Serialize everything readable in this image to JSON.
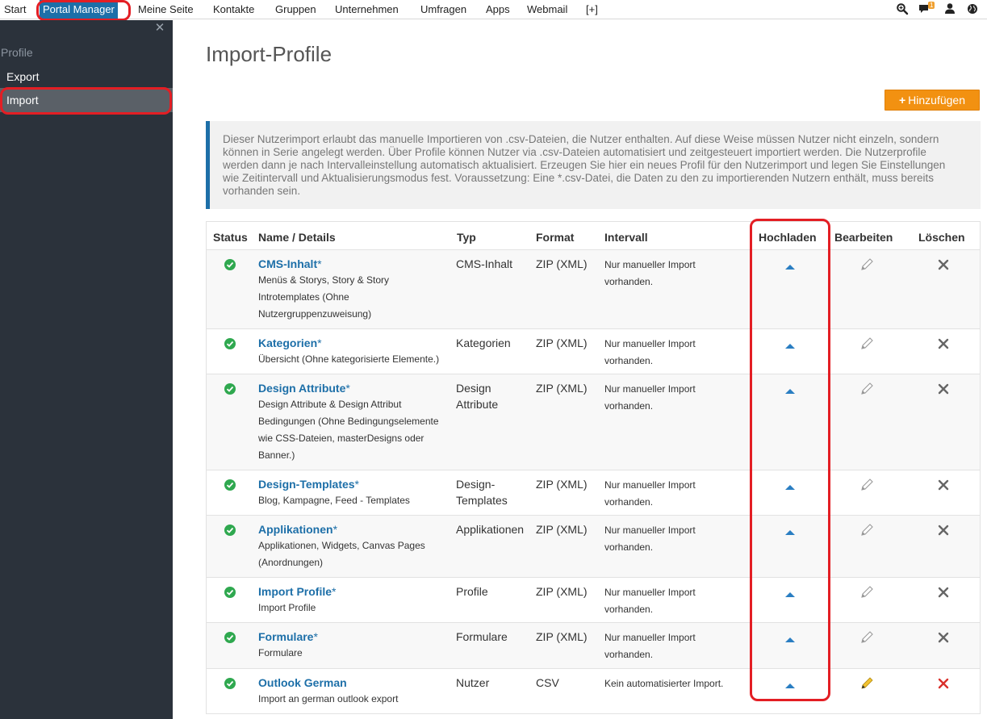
{
  "topnav": {
    "items": [
      "Start",
      "Portal Manager",
      "Meine Seite",
      "Kontakte",
      "Gruppen",
      "Unternehmen",
      "Umfragen",
      "Apps",
      "Webmail",
      "[+]"
    ],
    "active_index": 1,
    "notification_count": "1",
    "icons": [
      "search-icon",
      "chat-icon",
      "user-icon",
      "globe-icon"
    ]
  },
  "sidebar": {
    "section": "Profile",
    "items": [
      "Export",
      "Import"
    ],
    "active_index": 1
  },
  "main": {
    "title": "Import-Profile",
    "add_label": "Hinzufügen",
    "info": "Dieser Nutzerimport erlaubt das manuelle Importieren von .csv-Dateien, die Nutzer enthalten. Auf diese Weise müssen Nutzer nicht einzeln, sondern können in Serie angelegt werden. Über Profile können Nutzer via .csv-Dateien automatisiert und zeitgesteuert importiert werden. Die Nutzerprofile werden dann je nach Intervalleinstellung automatisch aktualisiert. Erzeugen Sie hier ein neues Profil für den Nutzerimport und legen Sie Einstellungen wie Zeitintervall und Aktualisierungsmodus fest. Voraussetzung: Eine *.csv-Datei, die Daten zu den zu importierenden Nutzern enthält, muss bereits vorhanden sein."
  },
  "table": {
    "headers": {
      "status": "Status",
      "name": "Name / Details",
      "type": "Typ",
      "format": "Format",
      "interval": "Intervall",
      "upload": "Hochladen",
      "edit": "Bearbeiten",
      "delete": "Löschen"
    },
    "rows": [
      {
        "name": "CMS-Inhalt",
        "star": "*",
        "detail": "Menüs & Storys, Story & Story Introtemplates (Ohne Nutzergruppenzuweisung)",
        "type": "CMS-Inhalt",
        "format": "ZIP (XML)",
        "interval": "Nur manueller Import vorhanden.",
        "deletable": false
      },
      {
        "name": "Kategorien",
        "star": "*",
        "detail": "Übersicht (Ohne kategorisierte Elemente.)",
        "type": "Kategorien",
        "format": "ZIP (XML)",
        "interval": "Nur manueller Import vorhanden.",
        "deletable": false
      },
      {
        "name": "Design Attribute",
        "star": "*",
        "detail": "Design Attribute & Design Attribut Bedingungen (Ohne Bedingungselemente wie CSS-Dateien, masterDesigns oder Banner.)",
        "type": "Design Attribute",
        "format": "ZIP (XML)",
        "interval": "Nur manueller Import vorhanden.",
        "deletable": false
      },
      {
        "name": "Design-Templates",
        "star": "*",
        "detail": "Blog, Kampagne, Feed - Templates",
        "type": "Design-Templates",
        "format": "ZIP (XML)",
        "interval": "Nur manueller Import vorhanden.",
        "deletable": false
      },
      {
        "name": "Applikationen",
        "star": "*",
        "detail": "Applikationen, Widgets, Canvas Pages (Anordnungen)",
        "type": "Applikationen",
        "format": "ZIP (XML)",
        "interval": "Nur manueller Import vorhanden.",
        "deletable": false
      },
      {
        "name": "Import Profile",
        "star": "*",
        "detail": "Import Profile",
        "type": "Profile",
        "format": "ZIP (XML)",
        "interval": "Nur manueller Import vorhanden.",
        "deletable": false
      },
      {
        "name": "Formulare",
        "star": "*",
        "detail": "Formulare",
        "type": "Formulare",
        "format": "ZIP (XML)",
        "interval": "Nur manueller Import vorhanden.",
        "deletable": false
      },
      {
        "name": "Outlook German",
        "star": "",
        "detail": "Import an german outlook export",
        "type": "Nutzer",
        "format": "CSV",
        "interval": "Kein automatisierter Import.",
        "deletable": true
      }
    ]
  },
  "colors": {
    "accent": "#1d6fa8",
    "sidebar_bg": "#2b323b",
    "add_button": "#f29111",
    "highlight": "#e31e24",
    "status_ok": "#2fa84f"
  }
}
